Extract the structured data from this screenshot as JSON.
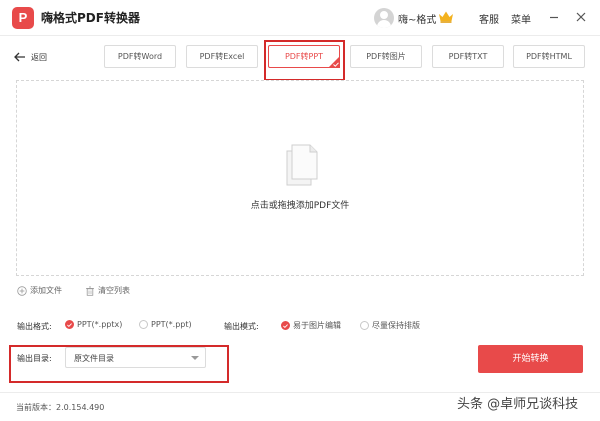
{
  "app": {
    "logo_letter": "P",
    "title": "嗨格式PDF转换器"
  },
  "user": {
    "name": "嗨~格式"
  },
  "titlebar": {
    "service": "客服",
    "menu": "菜单"
  },
  "nav": {
    "back_label": "返回"
  },
  "tabs": [
    {
      "label": "PDF转Word",
      "active": false
    },
    {
      "label": "PDF转Excel",
      "active": false
    },
    {
      "label": "PDF转PPT",
      "active": true
    },
    {
      "label": "PDF转图片",
      "active": false
    },
    {
      "label": "PDF转TXT",
      "active": false
    },
    {
      "label": "PDF转HTML",
      "active": false
    }
  ],
  "dropzone": {
    "text": "点击或拖拽添加PDF文件"
  },
  "actions": {
    "add_file": "添加文件",
    "clear_list": "清空列表"
  },
  "options": {
    "format_label": "输出格式:",
    "format_choices": [
      {
        "label": "PPT(*.pptx)",
        "selected": true
      },
      {
        "label": "PPT(*.ppt)",
        "selected": false
      }
    ],
    "mode_label": "输出模式:",
    "mode_choices": [
      {
        "label": "易于图片编辑",
        "selected": true
      },
      {
        "label": "尽量保持排版",
        "selected": false
      }
    ]
  },
  "output_dir": {
    "label": "输出目录:",
    "value": "原文件目录"
  },
  "start_button": "开始转换",
  "footer": {
    "version": "当前版本：2.0.154.490"
  },
  "watermark": "头条 @卓师兄谈科技",
  "colors": {
    "accent": "#e84a4a",
    "highlight": "#d42a2a"
  }
}
